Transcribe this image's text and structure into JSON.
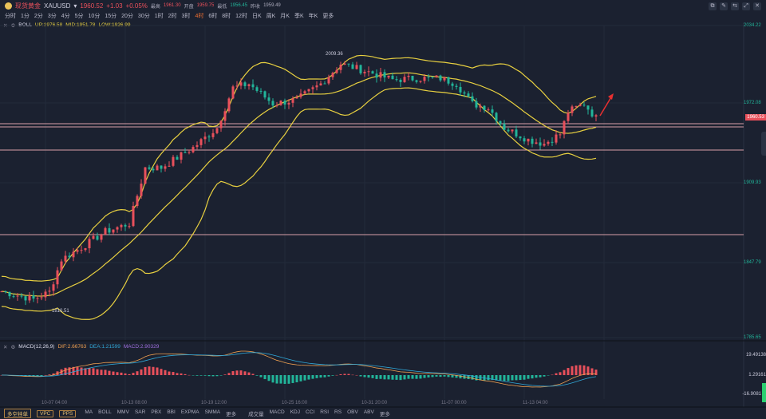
{
  "header": {
    "name": "现货黄金",
    "symbol": "XAUUSD",
    "price": "1960.52",
    "change": "+1.03",
    "change_pct": "+0.05%",
    "high_label": "最高",
    "high": "1961.30",
    "open_label": "开盘",
    "open": "1959.75",
    "low_label": "最低",
    "low": "1956.45",
    "prev_label": "昨收",
    "prev": "1959.49"
  },
  "timeframes": [
    "分时",
    "1分",
    "2分",
    "3分",
    "4分",
    "5分",
    "10分",
    "15分",
    "20分",
    "30分",
    "1时",
    "2时",
    "3时",
    "4时",
    "6时",
    "8时",
    "12时",
    "日K",
    "周K",
    "月K",
    "季K",
    "年K",
    "更多"
  ],
  "active_timeframe": "4时",
  "boll": {
    "name": "BOLL",
    "up": "UP:1976.58",
    "mid": "MID:1951.78",
    "low": "LOW:1926.99"
  },
  "macd": {
    "name": "MACD(12,26,9)",
    "dif": "DIF:2.66763",
    "dea": "DEA:1.21599",
    "macd": "MACD:2.90329"
  },
  "price_axis": [
    "2034.22",
    "1972.08",
    "1909.93",
    "1847.79",
    "1785.65"
  ],
  "current_price": "1960.53",
  "macd_axis": [
    "19.49138",
    "1.29161",
    "-16.9081"
  ],
  "annotations": {
    "high": "2009.36",
    "low": "1810.51"
  },
  "time_labels": [
    "10-07 04:00",
    "10-13 08:00",
    "10-19 12:00",
    "10-25 16:00",
    "10-31 20:00",
    "11-07 00:00",
    "11-13 04:00"
  ],
  "bottom_buttons": [
    "多空挂单",
    "VPC",
    "PPS"
  ],
  "main_indicators": [
    "MA",
    "BOLL",
    "MMV",
    "SAR",
    "PBX",
    "BBI",
    "EXPMA",
    "SMMA",
    "更多"
  ],
  "sub_indicators": [
    "成交量",
    "MACD",
    "KDJ",
    "CCI",
    "RSI",
    "RS",
    "OBV",
    "ABV",
    "更多"
  ],
  "colors": {
    "up": "#e8505b",
    "down": "#22b59a",
    "boll": "#e8d040",
    "bg": "#1b2130"
  },
  "chart_data": {
    "type": "candlestick",
    "price_keypoints": [
      [
        0,
        1822.5
      ],
      [
        8,
        1816.2
      ],
      [
        12,
        1822
      ],
      [
        15,
        1847.9
      ],
      [
        20,
        1857.4
      ],
      [
        26,
        1870.1
      ],
      [
        32,
        1876.5
      ],
      [
        36,
        1921.0
      ],
      [
        40,
        1921
      ],
      [
        48,
        1936.9
      ],
      [
        54,
        1952.8
      ],
      [
        58,
        1984.6
      ],
      [
        62,
        1987.8
      ],
      [
        68,
        1971.9
      ],
      [
        74,
        1975.1
      ],
      [
        80,
        1987.8
      ],
      [
        85,
        2003.7
      ],
      [
        92,
        1997.3
      ],
      [
        98,
        1991
      ],
      [
        104,
        1992.2
      ],
      [
        110,
        1992.2
      ],
      [
        114,
        1987.8
      ],
      [
        118,
        1971.9
      ],
      [
        122,
        1968.7
      ],
      [
        126,
        1952.8
      ],
      [
        132,
        1943.3
      ],
      [
        136,
        1940.1
      ],
      [
        140,
        1947.8
      ],
      [
        142,
        1965.6
      ],
      [
        146,
        1971.9
      ],
      [
        149,
        1960.5
      ]
    ]
  }
}
